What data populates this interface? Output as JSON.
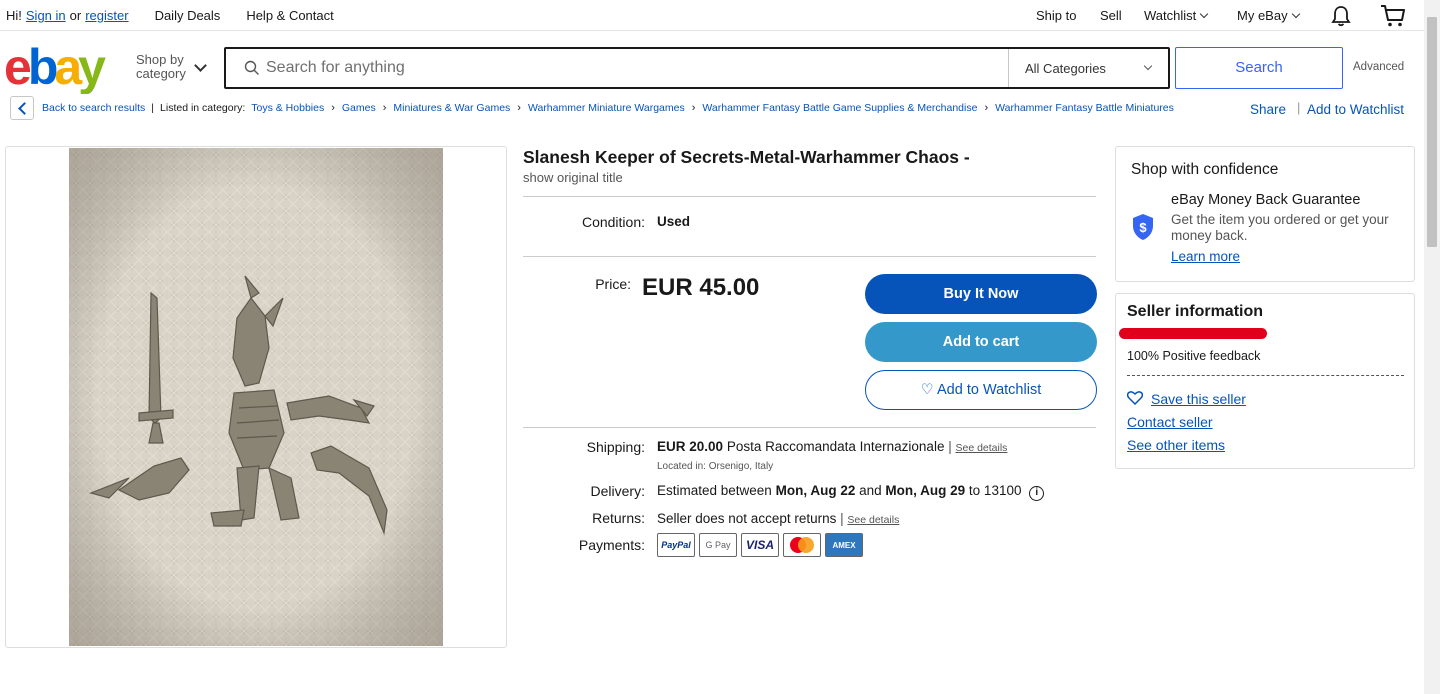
{
  "topbar": {
    "greeting": "Hi!",
    "sign_in": "Sign in",
    "or": "or",
    "register": "register",
    "daily_deals": "Daily Deals",
    "help_contact": "Help & Contact",
    "ship_to": "Ship to",
    "sell": "Sell",
    "watchlist": "Watchlist",
    "my_ebay": "My eBay"
  },
  "header": {
    "shop_by_line1": "Shop by",
    "shop_by_line2": "category",
    "search_placeholder": "Search for anything",
    "category_select": "All Categories",
    "search_button": "Search",
    "advanced": "Advanced"
  },
  "breadcrumb": {
    "back": "Back to search results",
    "listed_in": "Listed in category:",
    "items": [
      "Toys & Hobbies",
      "Games",
      "Miniatures & War Games",
      "Warhammer Miniature Wargames",
      "Warhammer Fantasy Battle Game Supplies & Merchandise",
      "Warhammer Fantasy Battle Miniatures"
    ],
    "share": "Share",
    "add_watchlist": "Add to Watchlist"
  },
  "listing": {
    "title": "Slanesh Keeper of Secrets-Metal-Warhammer Chaos -",
    "show_original": "show original title",
    "condition_label": "Condition:",
    "condition_value": "Used",
    "price_label": "Price:",
    "price": "EUR 45.00",
    "buy_now": "Buy It Now",
    "add_to_cart": "Add to cart",
    "add_to_watchlist": "♡ Add to Watchlist",
    "shipping_label": "Shipping:",
    "shipping_cost": "EUR 20.00",
    "shipping_service": "Posta Raccomandata Internazionale",
    "see_details": "See details",
    "located": "Located in: Orsenigo, Italy",
    "delivery_label": "Delivery:",
    "delivery_pre": "Estimated between",
    "delivery_from": "Mon, Aug 22",
    "delivery_and": "and",
    "delivery_to": "Mon, Aug 29",
    "delivery_zip": "to 13100",
    "returns_label": "Returns:",
    "returns_value": "Seller does not accept returns",
    "payments_label": "Payments:",
    "payments": [
      "PayPal",
      "G Pay",
      "VISA",
      "Mastercard",
      "AMEX"
    ]
  },
  "confidence": {
    "title": "Shop with confidence",
    "guarantee": "eBay Money Back Guarantee",
    "desc": "Get the item you ordered or get your money back.",
    "learn_more": "Learn more"
  },
  "seller": {
    "title": "Seller information",
    "feedback": "100% Positive feedback",
    "save": "Save this seller",
    "contact": "Contact seller",
    "other_items": "See other items"
  },
  "colors": {
    "ebay_red": "#e53238",
    "ebay_blue": "#0064d2",
    "ebay_yellow": "#f5af02",
    "ebay_green": "#86b817",
    "buy_button": "#0654ba",
    "cart_button": "#3498ca",
    "link": "#0654ba"
  }
}
